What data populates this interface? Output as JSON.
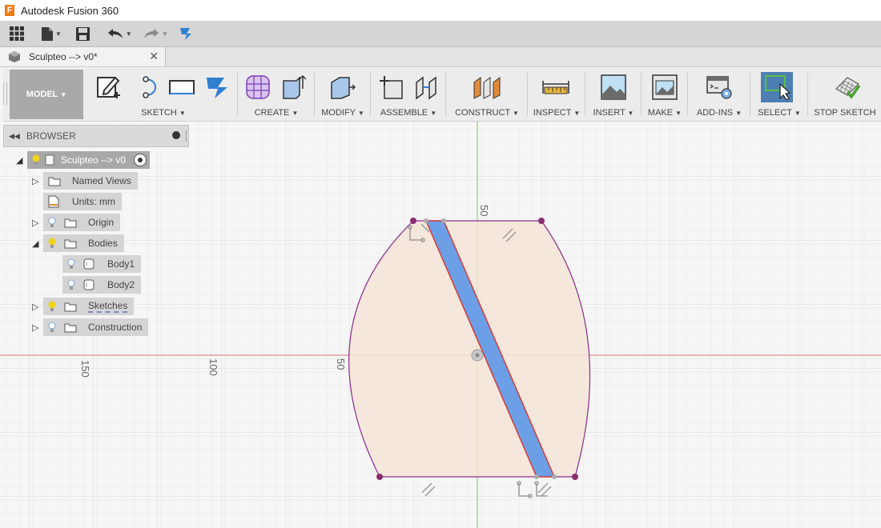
{
  "window": {
    "title": "Autodesk Fusion 360"
  },
  "document_tab": {
    "title": "Sculpteo --> v0*",
    "close_glyph": "✕"
  },
  "ribbon": {
    "workspace": "MODEL",
    "groups": {
      "sketch": "SKETCH",
      "create": "CREATE",
      "modify": "MODIFY",
      "assemble": "ASSEMBLE",
      "construct": "CONSTRUCT",
      "inspect": "INSPECT",
      "insert": "INSERT",
      "make": "MAKE",
      "addins": "ADD-INS",
      "select": "SELECT",
      "stop_sketch": "STOP SKETCH"
    },
    "caret": "▼"
  },
  "browser": {
    "title": "BROWSER",
    "root": "Sculpteo --> v0",
    "items": {
      "named_views": "Named Views",
      "units": "Units: mm",
      "origin": "Origin",
      "bodies": "Bodies",
      "body1": "Body1",
      "body2": "Body2",
      "sketches": "Sketches",
      "construction": "Construction"
    }
  },
  "viewport": {
    "dimensions": {
      "d1": "50",
      "d2": "150",
      "d3": "100",
      "d4": "50"
    },
    "colors": {
      "grid": "#e2e2e2",
      "profile_fill": "#f4e4d6",
      "profile_stroke": "#8a2d8a",
      "slot_fill": "#6d9fe6",
      "x_axis": "#e07070",
      "y_axis": "#8fd37a"
    }
  }
}
